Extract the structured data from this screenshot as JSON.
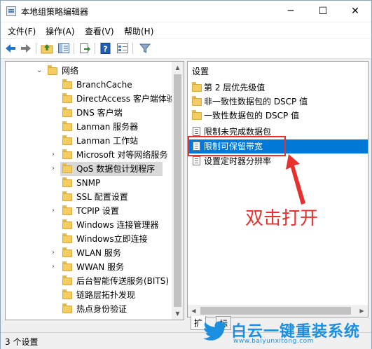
{
  "window": {
    "title": "本地组策略编辑器",
    "minimize": "─",
    "maximize": "☐",
    "close": "✕"
  },
  "menu": [
    {
      "label": "文件(F)"
    },
    {
      "label": "操作(A)"
    },
    {
      "label": "查看(V)"
    },
    {
      "label": "帮助(H)"
    }
  ],
  "toolbar": {
    "buttons": [
      "back-icon",
      "forward-icon",
      "up-folder-icon",
      "show-hide-tree-icon",
      "export-list-icon",
      "help-icon",
      "properties-icon",
      "filter-icon"
    ]
  },
  "tree": {
    "items": [
      {
        "label": "网络",
        "expanded": true,
        "has_children": true
      },
      {
        "label": "BranchCache"
      },
      {
        "label": "DirectAccess 客户端体验"
      },
      {
        "label": "DNS 客户端"
      },
      {
        "label": "Lanman 服务器"
      },
      {
        "label": "Lanman 工作站"
      },
      {
        "label": "Microsoft 对等网络服务",
        "has_children": true
      },
      {
        "label": "QoS 数据包计划程序",
        "has_children": true,
        "selected": true
      },
      {
        "label": "SNMP"
      },
      {
        "label": "SSL 配置设置"
      },
      {
        "label": "TCPIP 设置",
        "has_children": true
      },
      {
        "label": "Windows 连接管理器"
      },
      {
        "label": "Windows立即连接"
      },
      {
        "label": "WLAN 服务",
        "has_children": true
      },
      {
        "label": "WWAN 服务",
        "has_children": true
      },
      {
        "label": "后台智能传送服务(BITS)"
      },
      {
        "label": "链路层拓扑发现"
      },
      {
        "label": "热点身份验证"
      }
    ]
  },
  "list": {
    "header": "设置",
    "items": [
      {
        "label": "第 2 层优先级值",
        "type": "folder"
      },
      {
        "label": "非一致性数据包的 DSCP 值",
        "type": "folder"
      },
      {
        "label": "一致性数据包的 DSCP 值",
        "type": "folder"
      },
      {
        "label": "限制未完成数据包",
        "type": "setting"
      },
      {
        "label": "限制可保留带宽",
        "type": "setting",
        "selected": true
      },
      {
        "label": "设置定时器分辨率",
        "type": "setting"
      }
    ]
  },
  "tabs": [
    {
      "label": "扩展"
    },
    {
      "label": "标准"
    }
  ],
  "annotation": {
    "text": "双击打开",
    "color": "#e8312f"
  },
  "status": {
    "text": "3 个设置"
  },
  "watermark": {
    "brand": "白云一键重装系统",
    "url": "www.baiyunxitong.com"
  },
  "colors": {
    "selection": "#0078d7",
    "highlight_box": "#e8312f",
    "brand_blue": "#1d8fe0"
  }
}
